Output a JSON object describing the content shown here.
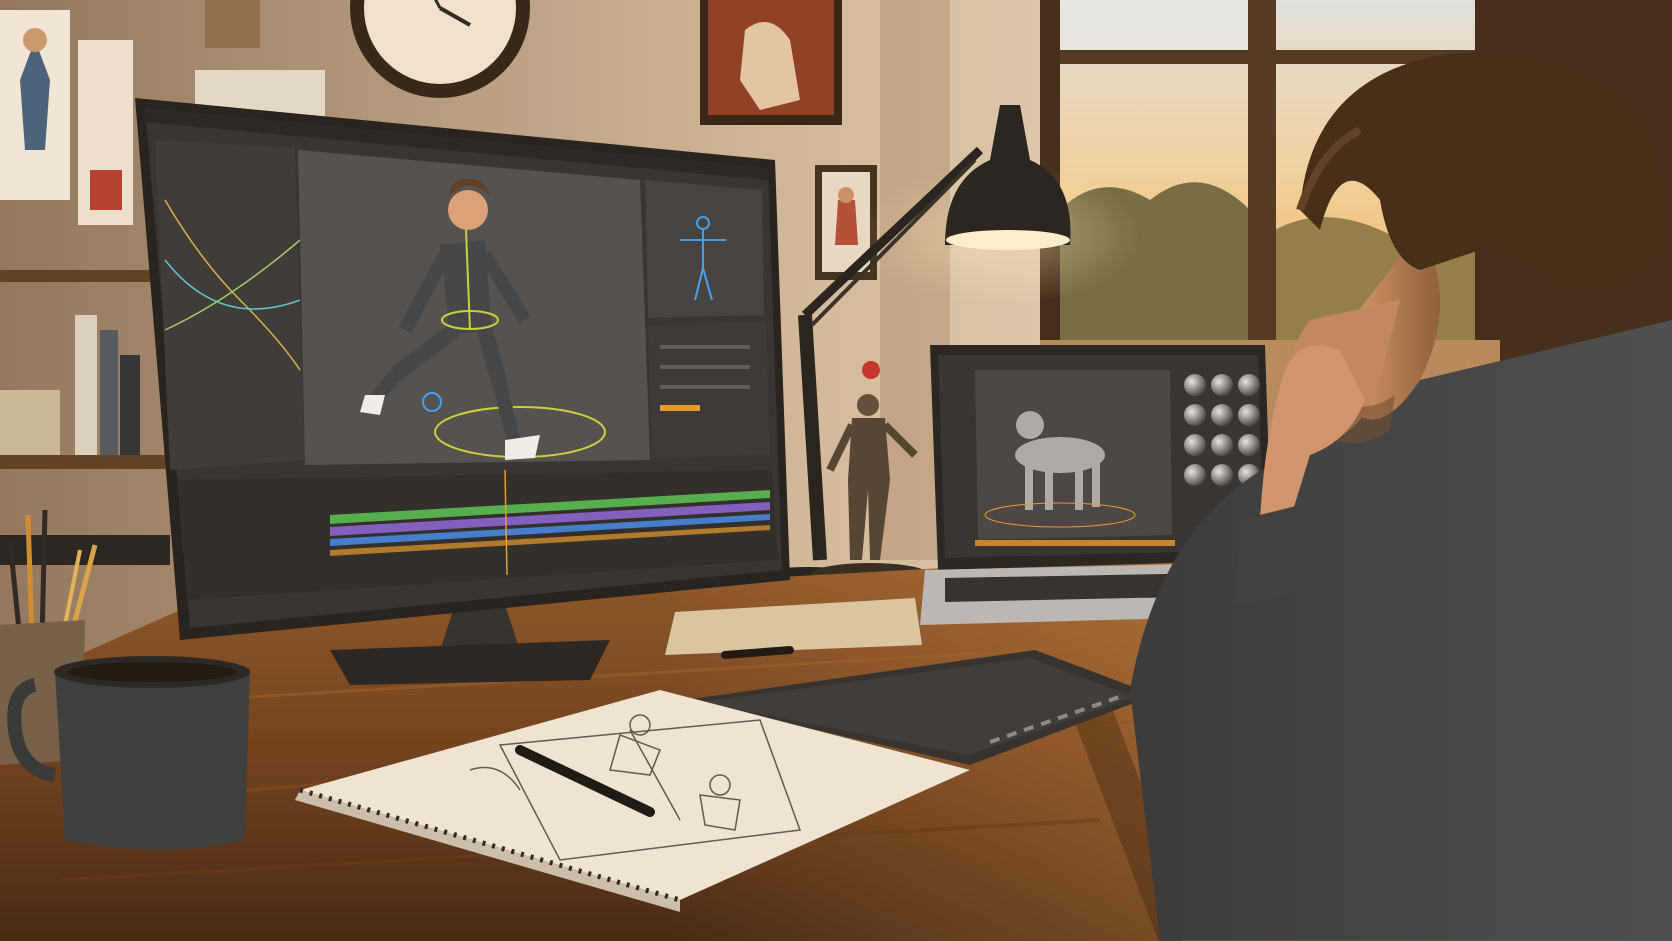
{
  "palette": {
    "wall": "#d9c6ae",
    "wall_shadow": "#a88c70",
    "window_light": "#f4c98a",
    "desk": "#6b3f1e",
    "desk_light": "#a86a34",
    "screen_bg": "#2b2d31",
    "viewport_bg": "#4a4c50",
    "accent_orange": "#e89a2c",
    "rig_yellow": "#c8d23a",
    "rig_blue": "#3aa0ff",
    "timeline_green": "#4caf50",
    "timeline_purple": "#7b5ac8",
    "timeline_blue": "#3a7bd5",
    "skin": "#c9946e",
    "hair": "#3b2617",
    "shirt": "#3b3f46"
  },
  "scene": {
    "main_monitor": {
      "app": "3d-animation-software",
      "viewport_subject": "character-walk-cycle-rig",
      "side_panel_subject": "skeleton-preview",
      "timeline_tracks": [
        "green",
        "purple",
        "blue",
        "orange"
      ]
    },
    "laptop": {
      "viewport_subject": "quadruped-dog-model",
      "side_panel_subject": "material-spheres",
      "material_sphere_count": 12
    },
    "desk_items": [
      "coffee-mug",
      "pencil-cup",
      "sketchbook",
      "pen",
      "drawing-tablet",
      "figurine",
      "desk-lamp",
      "closed-notebook"
    ],
    "wall_items": [
      "wall-clock",
      "framed-poster",
      "character-sketches",
      "framed-figure-drawing"
    ]
  }
}
